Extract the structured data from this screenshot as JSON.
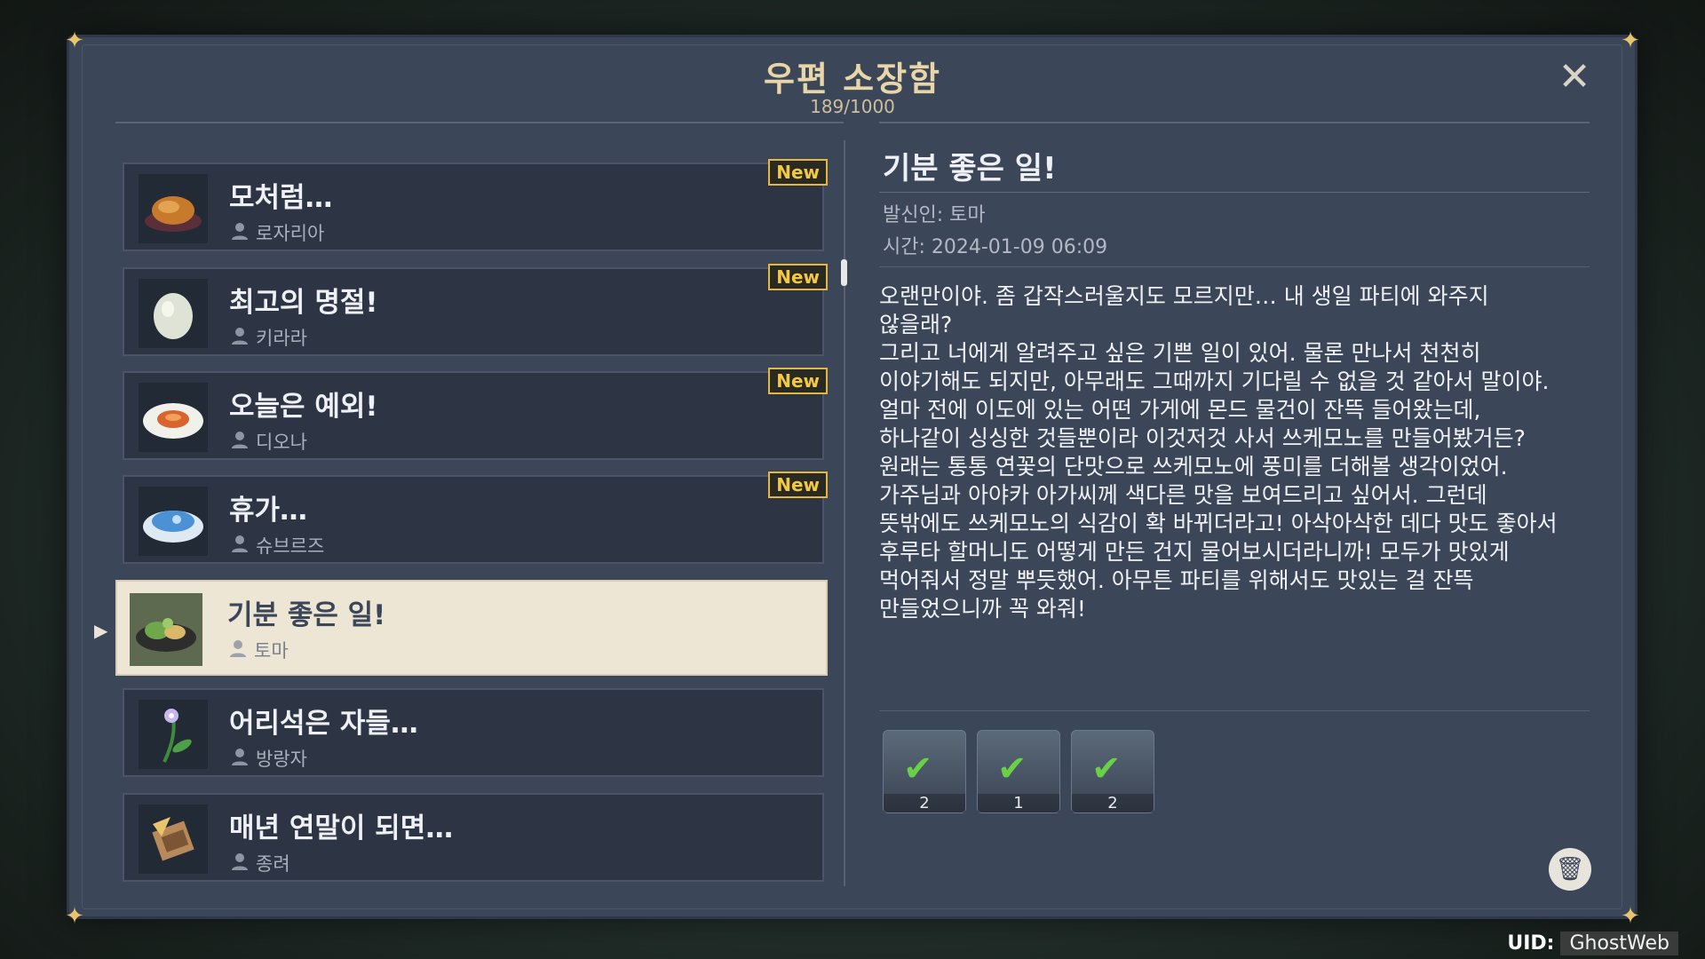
{
  "window": {
    "title": "우편 소장함",
    "count": "189/1000",
    "close_icon": "close-icon"
  },
  "mails": [
    {
      "subject": "모처럼…",
      "sender": "로자리아",
      "new_label": "New",
      "icon": "roast-chicken-icon"
    },
    {
      "subject": "최고의 명절!",
      "sender": "키라라",
      "new_label": "New",
      "icon": "egg-icon"
    },
    {
      "subject": "오늘은 예외!",
      "sender": "디오나",
      "new_label": "New",
      "icon": "fish-dish-icon"
    },
    {
      "subject": "휴가…",
      "sender": "슈브르즈",
      "new_label": "New",
      "icon": "blue-dish-icon"
    },
    {
      "subject": "기분 좋은 일!",
      "sender": "토마",
      "icon": "salad-plate-icon",
      "selected": true
    },
    {
      "subject": "어리석은 자들…",
      "sender": "방랑자",
      "icon": "flower-icon"
    },
    {
      "subject": "매년 연말이 되면…",
      "sender": "종려",
      "icon": "scroll-bundle-icon"
    }
  ],
  "detail": {
    "subject": "기분 좋은 일!",
    "sender": "발신인: 토마",
    "time": "시간: 2024-01-09 06:09",
    "body_lines": [
      "오랜만이야. 좀 갑작스러울지도 모르지만… 내 생일 파티에 와주지",
      "않을래?",
      "그리고 너에게 알려주고 싶은 기쁜 일이 있어. 물론 만나서 천천히",
      "이야기해도 되지만, 아무래도 그때까지 기다릴 수 없을 것 같아서 말이야.",
      "얼마 전에 이도에 있는 어떤 가게에 몬드 물건이 잔뜩 들어왔는데,",
      "하나같이 싱싱한 것들뿐이라 이것저것 사서 쓰케모노를 만들어봤거든?",
      "원래는 통통 연꽃의 단맛으로 쓰케모노에 풍미를 더해볼 생각이었어.",
      "가주님과 아야카 아가씨께 색다른 맛을 보여드리고 싶어서. 그런데",
      "뜻밖에도 쓰케모노의 식감이 확 바뀌더라고! 아삭아삭한 데다 맛도 좋아서",
      "후루타 할머니도 어떻게 만든 건지 물어보시더라니까! 모두가 맛있게",
      "먹어줘서 정말 뿌듯했어. 아무튼 파티를 위해서도 맛있는 걸 잔뜩",
      "만들었으니까 꼭 와줘!"
    ],
    "attachments": [
      {
        "icon": "veggie-dish-icon",
        "count": "2",
        "claimed": true
      },
      {
        "icon": "hotpot-icon",
        "count": "1",
        "claimed": true
      },
      {
        "icon": "fish-platter-icon",
        "count": "2",
        "claimed": true
      }
    ],
    "delete_icon": "trash-icon"
  },
  "uid": {
    "label": "UID:",
    "value": "GhostWeb"
  },
  "colors": {
    "accent_gold": "#e6b738",
    "panel": "#3c4659",
    "selected_bg": "#ede6d4",
    "check_green": "#6ad047"
  }
}
